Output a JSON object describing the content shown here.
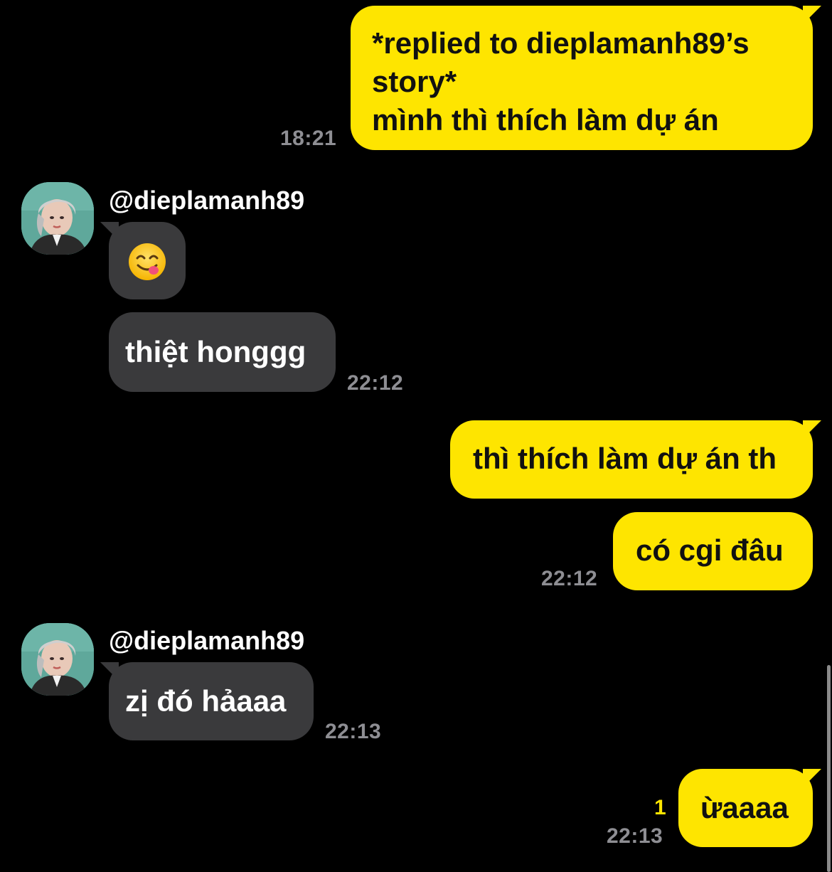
{
  "messages": [
    {
      "direction": "outgoing",
      "lines": [
        "*replied to dieplamanh89’s",
        "story*",
        "mình thì thích làm dự án"
      ],
      "time": "18:21"
    },
    {
      "direction": "incoming",
      "sender": "@dieplamanh89",
      "emoji": "yum-face-icon"
    },
    {
      "direction": "incoming",
      "text": "thiệt honggg",
      "time": "22:12"
    },
    {
      "direction": "outgoing",
      "text": "thì thích làm dự án th"
    },
    {
      "direction": "outgoing",
      "text": "có cgi đâu",
      "time": "22:12"
    },
    {
      "direction": "incoming",
      "sender": "@dieplamanh89",
      "text": "zị đó hảaaa",
      "time": "22:13"
    },
    {
      "direction": "outgoing",
      "text": "ừaaaa",
      "unread_count": "1",
      "time": "22:13"
    }
  ],
  "colors": {
    "background": "#000000",
    "outgoing_bubble": "#FEE500",
    "incoming_bubble": "#3A3A3C",
    "timestamp": "#8E8E93",
    "unread": "#FEE500"
  }
}
